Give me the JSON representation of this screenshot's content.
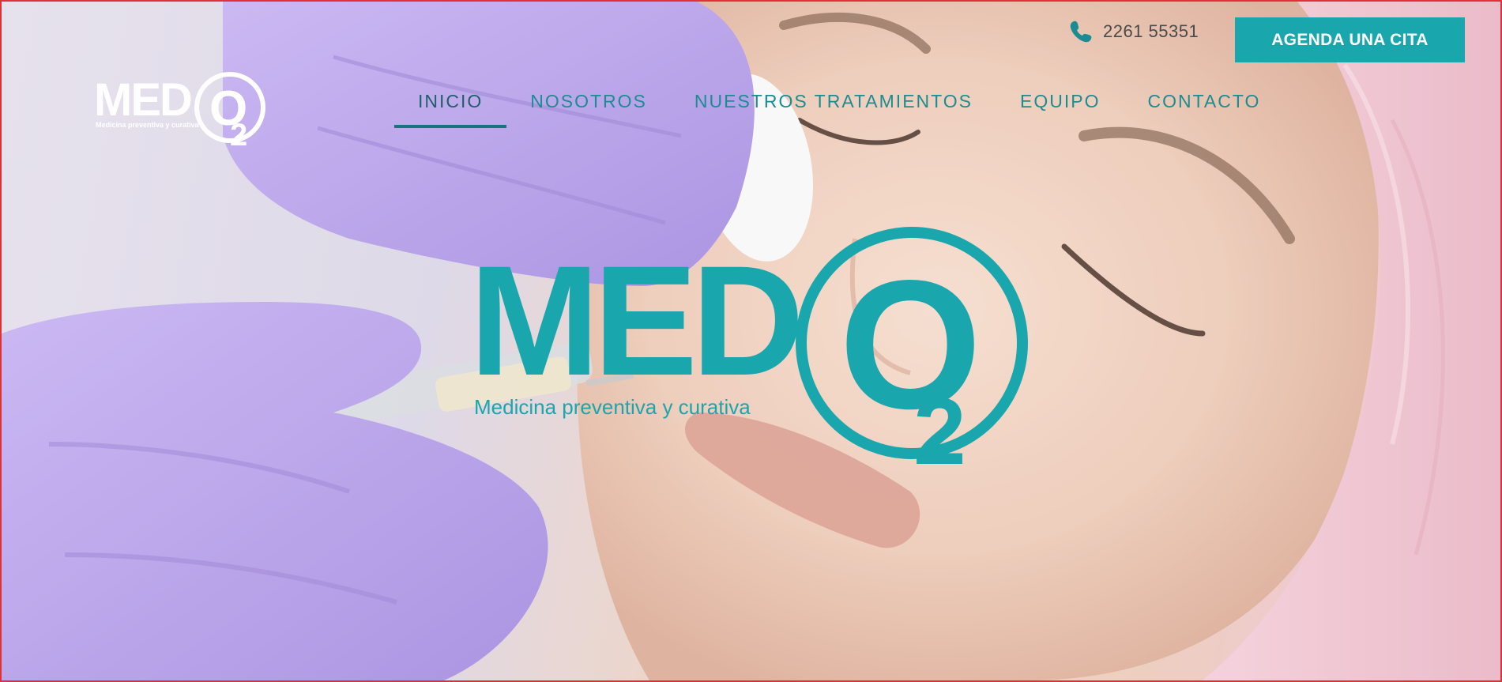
{
  "header": {
    "phone": "2261 55351",
    "cta_label": "AGENDA UNA CITA",
    "logo": {
      "wordmark": "MED",
      "mark": "O",
      "subscript": "2",
      "tagline": "Medicina preventiva y curativa"
    }
  },
  "nav": {
    "items": [
      {
        "label": "INICIO",
        "active": true
      },
      {
        "label": "NOSOTROS",
        "active": false
      },
      {
        "label": "NUESTROS TRATAMIENTOS",
        "active": false
      },
      {
        "label": "EQUIPO",
        "active": false
      },
      {
        "label": "CONTACTO",
        "active": false
      }
    ]
  },
  "hero": {
    "logo": {
      "wordmark": "MED",
      "mark": "O",
      "subscript": "2",
      "tagline": "Medicina preventiva y curativa"
    }
  },
  "colors": {
    "accent": "#1aa6ad",
    "nav_text": "#1c8c90",
    "nav_active": "#17737c",
    "glove": "#b9a2ec",
    "cap": "#f1c3d1"
  }
}
